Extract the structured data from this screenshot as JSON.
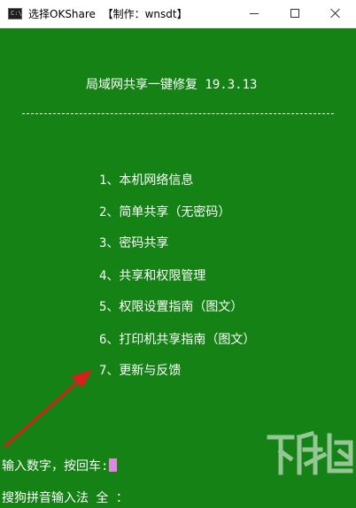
{
  "window": {
    "icon": "console-icon",
    "icon_prompt": "C:\\",
    "title": "选择OKShare  【制作：wnsdt】",
    "controls": [
      "minimize-icon",
      "maximize-icon",
      "close-icon"
    ]
  },
  "console": {
    "background": "#148214",
    "text_color": "#ffffff",
    "heading": "局域网共享一键修复 19.3.13",
    "menu": [
      {
        "label": "1、本机网络信息"
      },
      {
        "label": "2、简单共享（无密码）"
      },
      {
        "label": "3、密码共享"
      },
      {
        "label": "4、共享和权限管理"
      },
      {
        "label": "5、权限设置指南（图文）"
      },
      {
        "label": "6、打印机共享指南（图文）"
      },
      {
        "label": "7、更新与反馈"
      }
    ],
    "prompt": "输入数字，按回车:",
    "ime_status": "搜狗拼音输入法 全 ："
  },
  "annotation": {
    "arrow_color": "#d81e1e",
    "points_to": "7、更新与反馈"
  },
  "watermark": {
    "text": "下载吧"
  }
}
